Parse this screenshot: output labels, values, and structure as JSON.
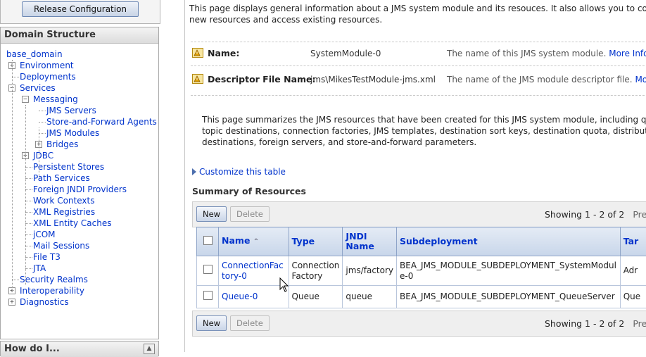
{
  "left": {
    "release_button": "Release Configuration",
    "domain_panel_title": "Domain Structure",
    "howdoi_title": "How do I...",
    "tree": [
      {
        "label": "base_domain",
        "level": 0,
        "toggle": ""
      },
      {
        "label": "Environment",
        "level": 1,
        "toggle": "+"
      },
      {
        "label": "Deployments",
        "level": 1,
        "toggle": ""
      },
      {
        "label": "Services",
        "level": 1,
        "toggle": "-"
      },
      {
        "label": "Messaging",
        "level": 2,
        "toggle": "-"
      },
      {
        "label": "JMS Servers",
        "level": 3,
        "toggle": ""
      },
      {
        "label": "Store-and-Forward Agents",
        "level": 3,
        "toggle": ""
      },
      {
        "label": "JMS Modules",
        "level": 3,
        "toggle": ""
      },
      {
        "label": "Bridges",
        "level": 3,
        "toggle": "+"
      },
      {
        "label": "JDBC",
        "level": 2,
        "toggle": "+"
      },
      {
        "label": "Persistent Stores",
        "level": 2,
        "toggle": ""
      },
      {
        "label": "Path Services",
        "level": 2,
        "toggle": ""
      },
      {
        "label": "Foreign JNDI Providers",
        "level": 2,
        "toggle": ""
      },
      {
        "label": "Work Contexts",
        "level": 2,
        "toggle": ""
      },
      {
        "label": "XML Registries",
        "level": 2,
        "toggle": ""
      },
      {
        "label": "XML Entity Caches",
        "level": 2,
        "toggle": ""
      },
      {
        "label": "jCOM",
        "level": 2,
        "toggle": ""
      },
      {
        "label": "Mail Sessions",
        "level": 2,
        "toggle": ""
      },
      {
        "label": "File T3",
        "level": 2,
        "toggle": ""
      },
      {
        "label": "JTA",
        "level": 2,
        "toggle": ""
      },
      {
        "label": "Security Realms",
        "level": 1,
        "toggle": ""
      },
      {
        "label": "Interoperability",
        "level": 1,
        "toggle": "+"
      },
      {
        "label": "Diagnostics",
        "level": 1,
        "toggle": "+"
      }
    ]
  },
  "main": {
    "intro_line1": "This page displays general information about a JMS system module and its resouces. It also allows you to configu",
    "intro_line2": "new resources and access existing resources.",
    "name_label": "Name:",
    "name_value": "SystemModule-0",
    "name_desc": "The name of this JMS system module.",
    "name_more": "More Info...",
    "descriptor_label": "Descriptor File Name:",
    "descriptor_value": "jms\\MikesTestModule-jms.xml",
    "descriptor_desc": "The name of the JMS module descriptor file.",
    "descriptor_more": "More",
    "summary_line1": "This page summarizes the JMS resources that have been created for this JMS system module, including queue",
    "summary_line2": "topic destinations, connection factories, JMS templates, destination sort keys, destination quota, distributed",
    "summary_line3": "destinations, foreign servers, and store-and-forward parameters.",
    "customize_link": "Customize this table",
    "summary_title": "Summary of Resources",
    "new_button": "New",
    "delete_button": "Delete",
    "showing_text": "Showing 1 - 2 of 2",
    "prev_text": "Prev",
    "table": {
      "headers": [
        "Name",
        "Type",
        "JNDI Name",
        "Subdeployment",
        "Tar"
      ],
      "rows": [
        {
          "name": "ConnectionFactory-0",
          "type": "Connection Factory",
          "jndi": "jms/factory",
          "subdeployment": "BEA_JMS_MODULE_SUBDEPLOYMENT_SystemModule-0",
          "target": "Adr"
        },
        {
          "name": "Queue-0",
          "type": "Queue",
          "jndi": "queue",
          "subdeployment": "BEA_JMS_MODULE_SUBDEPLOYMENT_QueueServer",
          "target": "Que"
        }
      ]
    }
  },
  "colors": {
    "link": "#0033cc",
    "header_bg": "#c8d6ea",
    "warn": "#e0a000"
  }
}
